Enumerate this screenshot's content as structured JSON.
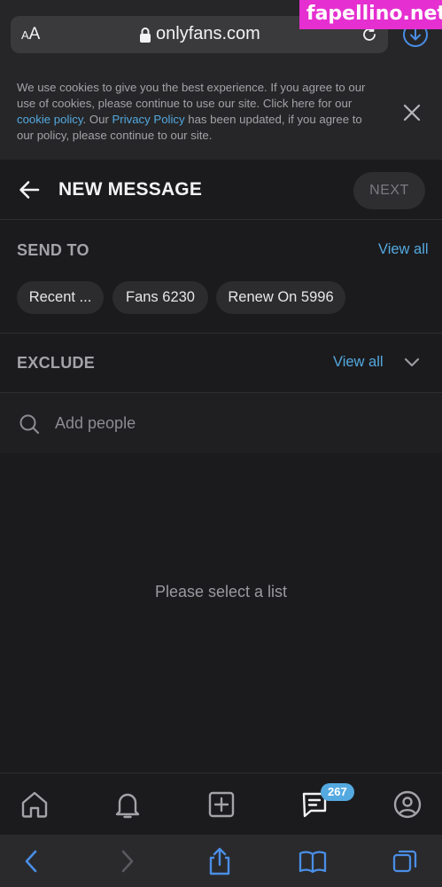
{
  "browser": {
    "text_size_label_small": "A",
    "text_size_label_large": "A",
    "url": "onlyfans.com",
    "watermark": "fapellino.net"
  },
  "cookie_banner": {
    "text_1": "We use cookies to give you the best experience. If you agree to our use of cookies, please continue to use our site. Click here for our ",
    "cookie_link": "cookie policy",
    "text_2": ". Our ",
    "privacy_link": "Privacy Policy",
    "text_3": " has been updated, if you agree to our policy, please continue to our site."
  },
  "header": {
    "title": "NEW MESSAGE",
    "next_label": "NEXT"
  },
  "send_to": {
    "label": "SEND TO",
    "view_all": "View all",
    "chips": [
      "Recent ...",
      "Fans 6230",
      "Renew On 5996"
    ]
  },
  "exclude": {
    "label": "EXCLUDE",
    "view_all": "View all"
  },
  "search": {
    "placeholder": "Add people"
  },
  "empty_state": "Please select a list",
  "bottom_nav": {
    "messages_badge": "267",
    "icons": [
      "home-icon",
      "bell-icon",
      "add-post-icon",
      "messages-icon",
      "profile-icon"
    ]
  },
  "colors": {
    "accent": "#54a9e0",
    "background": "#1b1b1d",
    "watermark": "#e52fd0"
  }
}
